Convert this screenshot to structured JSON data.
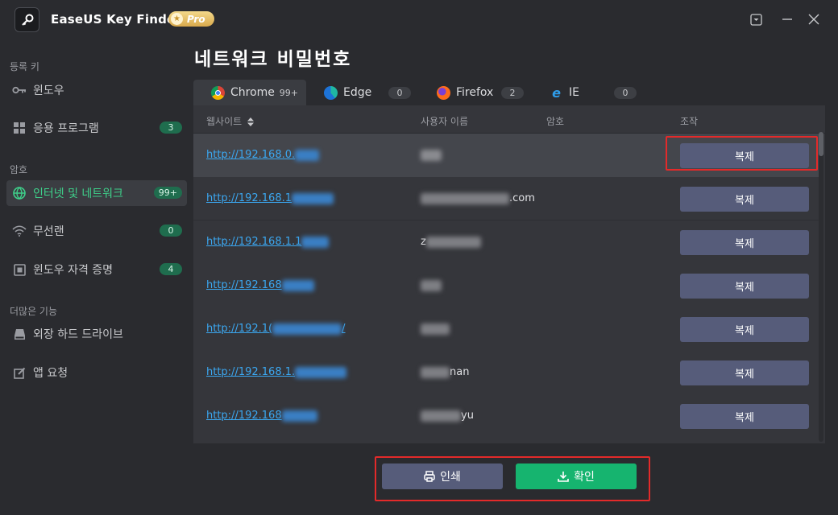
{
  "app": {
    "title": "EaseUS Key Finder",
    "badge": "Pro",
    "logo_icon": "key-icon"
  },
  "window_controls": [
    "dropdown-icon",
    "minimize-icon",
    "close-icon"
  ],
  "sidebar": {
    "sections": [
      {
        "title": "등록 키",
        "items": [
          {
            "label": "윈도우",
            "icon": "key-icon",
            "count": ""
          }
        ]
      },
      {
        "title": "",
        "items": [
          {
            "label": "응용 프로그램",
            "icon": "grid-icon",
            "count": "3"
          }
        ]
      },
      {
        "title": "암호",
        "items": [
          {
            "label": "인터넷 및 네트워크",
            "icon": "globe-icon",
            "count": "99+",
            "active": true
          },
          {
            "label": "무선랜",
            "icon": "wifi-icon",
            "count": "0"
          },
          {
            "label": "윈도우 자격 증명",
            "icon": "credential-icon",
            "count": "4"
          }
        ]
      },
      {
        "title": "더많은 기능",
        "items": [
          {
            "label": "외장 하드 드라이브",
            "icon": "drive-icon",
            "count": ""
          },
          {
            "label": "앱 요청",
            "icon": "edit-icon",
            "count": ""
          }
        ]
      }
    ]
  },
  "main": {
    "title": "네트워크 비밀번호",
    "tabs": [
      {
        "label": "Chrome",
        "count": "99+",
        "icon": "chrome-icon",
        "active": true
      },
      {
        "label": "Edge",
        "count": "0",
        "icon": "edge-icon"
      },
      {
        "label": "Firefox",
        "count": "2",
        "icon": "firefox-icon"
      },
      {
        "label": "IE",
        "count": "0",
        "icon": "ie-icon"
      }
    ],
    "table": {
      "columns": [
        "웹사이트",
        "사용자 이름",
        "암호",
        "조작"
      ],
      "sort_icon": "sort-icon",
      "rows": [
        {
          "site": "http://192.168.0.",
          "user": "",
          "action": "복제"
        },
        {
          "site": "http://192.168.1",
          "user": ".com",
          "action": "복제"
        },
        {
          "site": "http://192.168.1.1",
          "user": "z",
          "action": "복제"
        },
        {
          "site": "http://192.168",
          "user": "",
          "action": "복제"
        },
        {
          "site": "http://192.1(",
          "user": "",
          "action": "복제"
        },
        {
          "site": "http://192.168.1.",
          "user": "nan",
          "action": "복제"
        },
        {
          "site": "http://192.168",
          "user": "yu",
          "action": "복제"
        }
      ]
    },
    "print_label": "인쇄",
    "confirm_label": "확인"
  },
  "colors": {
    "accent": "#16b46f",
    "link": "#3ba7f0",
    "button": "#565c7a",
    "highlight": "#e32a2a"
  }
}
